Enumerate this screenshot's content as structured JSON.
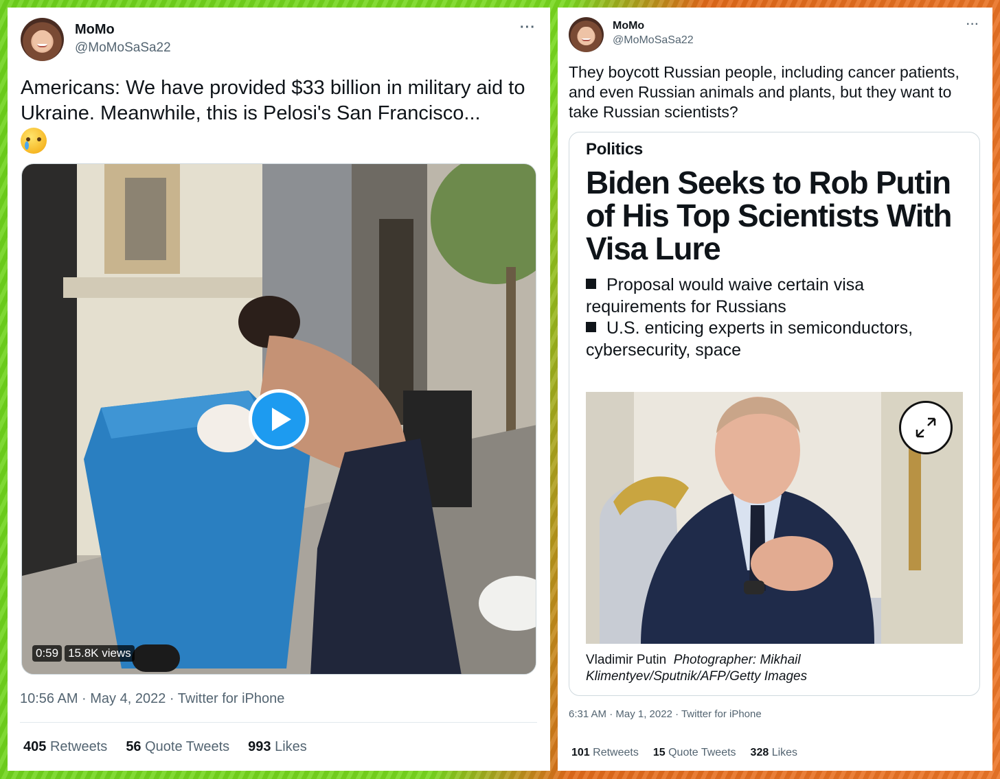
{
  "left_tweet": {
    "display_name": "MoMo",
    "handle": "@MoMoSaSa22",
    "more_label": "···",
    "text": "Americans: We have provided $33 billion in military aid to Ukraine. Meanwhile, this is Pelosi's San Francisco...",
    "emoji_icon": "crying-face-icon",
    "video": {
      "duration": "0:59",
      "views": "15.8K views"
    },
    "timestamp": "10:56 AM · May 4, 2022 · Twitter for iPhone",
    "stats": {
      "retweets_count": "405",
      "retweets_label": "Retweets",
      "quotes_count": "56",
      "quotes_label": "Quote Tweets",
      "likes_count": "993",
      "likes_label": "Likes"
    }
  },
  "right_tweet": {
    "display_name": "MoMo",
    "handle": "@MoMoSaSa22",
    "more_label": "···",
    "text": "They boycott Russian people, including cancer patients, and even Russian animals and plants, but they want to take Russian scientists?",
    "embed": {
      "section": "Politics",
      "headline": "Biden Seeks to Rob Putin of His Top Scientists With Visa Lure",
      "bullets": [
        "Proposal would waive certain visa requirements for Russians",
        "U.S. enticing experts in semiconductors, cybersecurity, space"
      ],
      "caption_subject": "Vladimir Putin",
      "caption_credit": "Photographer: Mikhail Klimentyev/Sputnik/AFP/Getty Images"
    },
    "timestamp": "6:31 AM · May 1, 2022 · Twitter for iPhone",
    "stats": {
      "retweets_count": "101",
      "retweets_label": "Retweets",
      "quotes_count": "15",
      "quotes_label": "Quote Tweets",
      "likes_count": "328",
      "likes_label": "Likes"
    }
  },
  "colors": {
    "accent_blue": "#1d9bf0",
    "text_primary": "#0f1419",
    "text_secondary": "#536471",
    "background_left": "#79d81f",
    "background_right": "#ec7628"
  }
}
